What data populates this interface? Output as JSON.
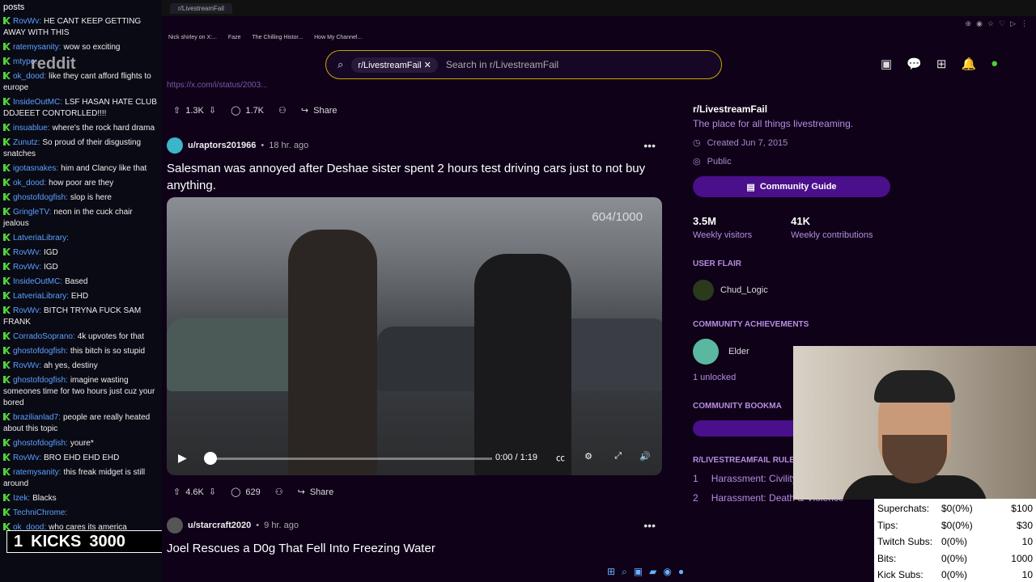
{
  "chat": {
    "header": "posts",
    "messages": [
      {
        "user": "RovWv:",
        "text": "HE CANT KEEP GETTING AWAY WITH THIS"
      },
      {
        "user": "ratemysanity:",
        "text": "wow so exciting"
      },
      {
        "user": "mtypo:",
        "text": ""
      },
      {
        "user": "ok_dood:",
        "text": "like they cant afford flights to europe"
      },
      {
        "user": "InsideOutMC:",
        "text": "LSF HASAN HATE CLUB DDJEEET CONTORLLED!!!!"
      },
      {
        "user": "insuablue:",
        "text": "where's the rock hard drama"
      },
      {
        "user": "Zunutz:",
        "text": "So proud of their disgusting snatches"
      },
      {
        "user": "igotasnakes:",
        "text": "him and Clancy like that"
      },
      {
        "user": "ok_dood:",
        "text": "how poor are they"
      },
      {
        "user": "ghostofdogfish:",
        "text": "slop is here"
      },
      {
        "user": "GringleTV:",
        "text": "neon in the cuck chair jealous"
      },
      {
        "user": "LatveriaLibrary:",
        "text": ""
      },
      {
        "user": "RovWv:",
        "text": "IGD"
      },
      {
        "user": "RovWv:",
        "text": "IGD"
      },
      {
        "user": "InsideOutMC:",
        "text": "Based"
      },
      {
        "user": "LatveriaLibrary:",
        "text": "EHD"
      },
      {
        "user": "RovWv:",
        "text": "BITCH TRYNA FUCK SAM FRANK"
      },
      {
        "user": "CorradoSoprano:",
        "text": "4k upvotes for that"
      },
      {
        "user": "ghostofdogfish:",
        "text": "this bitch is so stupid"
      },
      {
        "user": "RovWv:",
        "text": "ah yes, destiny"
      },
      {
        "user": "ghostofdogfish:",
        "text": "imagine wasting someones time for two hours just cuz your bored"
      },
      {
        "user": "brazilianlad7:",
        "text": "people are really heated about this topic"
      },
      {
        "user": "ghostofdogfish:",
        "text": "youre*"
      },
      {
        "user": "RovWv:",
        "text": "BRO EHD EHD EHD"
      },
      {
        "user": "ratemysanity:",
        "text": "this freak midget is still around"
      },
      {
        "user": "Izek:",
        "text": "Blacks"
      },
      {
        "user": "TechniChrome:",
        "text": ""
      },
      {
        "user": "ok_dood:",
        "text": "who cares its america"
      }
    ],
    "logo": "reddit",
    "kicks_goal": {
      "count": "1",
      "label": "KICKS",
      "target": "3000"
    }
  },
  "browser": {
    "tab": "r/LivestreamFail",
    "bookmarks": [
      "Nick shirley on X:...",
      "Faze",
      "The Chilling Histor...",
      "How My Channel..."
    ],
    "search": {
      "chip": "r/LivestreamFail",
      "placeholder": "Search in r/LivestreamFail"
    },
    "top_link": "https://x.com/i/status/2003..."
  },
  "posts": [
    {
      "upvotes": "1.3K",
      "comments": "1.7K",
      "share": "Share"
    },
    {
      "user": "u/raptors201966",
      "time": "18 hr. ago",
      "title": "Salesman was annoyed after Deshae sister spent 2 hours test driving cars just to not buy anything.",
      "video": {
        "watermark": "604/1000",
        "time": "0:00 / 1:19",
        "progress": 0.0
      },
      "upvotes": "4.6K",
      "comments": "629",
      "share": "Share"
    },
    {
      "user": "u/starcraft2020",
      "time": "9 hr. ago",
      "title": "Joel Rescues a D0g That Fell Into Freezing Water"
    }
  ],
  "sidebar": {
    "title": "r/LivestreamFail",
    "description": "The place for all things livestreaming.",
    "created": "Created Jun 7, 2015",
    "visibility": "Public",
    "guide_button": "Community Guide",
    "stats": [
      {
        "value": "3.5M",
        "label": "Weekly visitors"
      },
      {
        "value": "41K",
        "label": "Weekly contributions"
      }
    ],
    "user_flair_heading": "USER FLAIR",
    "flair": "Chud_Logic",
    "achievements_heading": "COMMUNITY ACHIEVEMENTS",
    "achievement": "Elder",
    "unlocked": "1 unlocked",
    "bookmarks_heading": "COMMUNITY BOOKMA",
    "rules_heading": "R/LIVESTREAMFAIL RULES",
    "rules": [
      {
        "n": "1",
        "text": "Harassment: Civility"
      },
      {
        "n": "2",
        "text": "Harassment: Death & Violence"
      }
    ]
  },
  "stream_stats": [
    {
      "label": "Superchats:",
      "value": "$0(0%)",
      "goal": "$100"
    },
    {
      "label": "Tips:",
      "value": "$0(0%)",
      "goal": "$30"
    },
    {
      "label": "Twitch Subs:",
      "value": "0(0%)",
      "goal": "10"
    },
    {
      "label": "Bits:",
      "value": "0(0%)",
      "goal": "1000"
    },
    {
      "label": "Kick Subs:",
      "value": "0(0%)",
      "goal": "10"
    }
  ]
}
